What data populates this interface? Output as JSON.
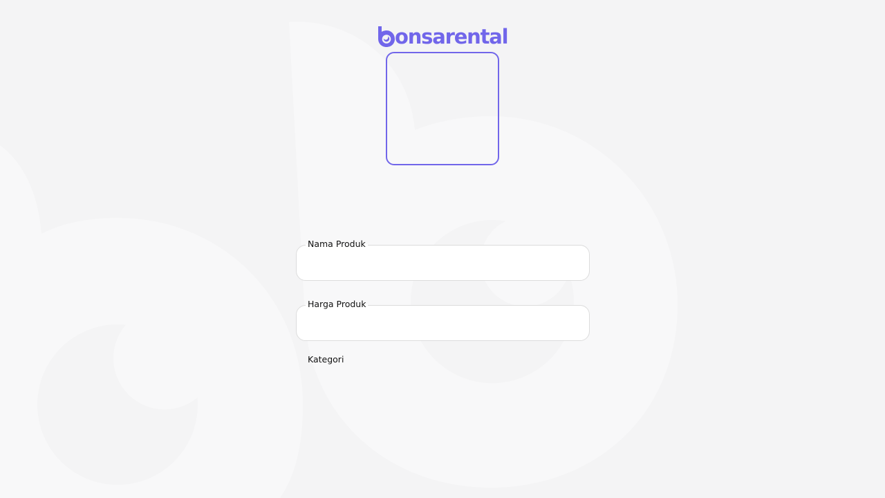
{
  "brand": {
    "logo_text": "onsarental",
    "full_name": "bonsarental",
    "accent_color": "#7166ea"
  },
  "image_upload": {
    "icon": "image-upload-frame"
  },
  "form": {
    "product_name": {
      "label": "Nama Produk",
      "value": ""
    },
    "product_price": {
      "label": "Harga Produk",
      "value": ""
    },
    "category": {
      "label": "Kategori"
    }
  },
  "colors": {
    "background": "#f4f4f5",
    "field_border": "#dcdcdc",
    "field_background": "#ffffff"
  }
}
